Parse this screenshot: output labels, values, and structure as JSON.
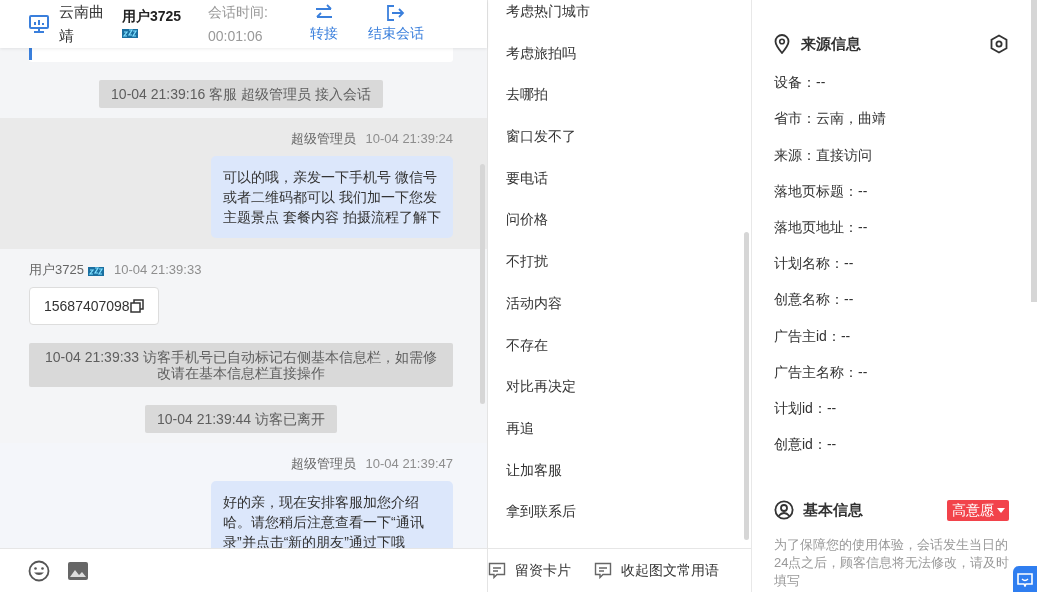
{
  "header": {
    "location": "云南曲靖",
    "user": "用户3725",
    "session_label": "会话时间:",
    "session_time": "00:01:06",
    "actions": [
      {
        "kind": "transfer",
        "label": "转接"
      },
      {
        "kind": "end",
        "label": "结束会话"
      }
    ]
  },
  "messages": [
    {
      "kind": "card"
    },
    {
      "kind": "system",
      "text": "10-04 21:39:16 客服 超级管理员 接入会话"
    },
    {
      "kind": "agent",
      "highlighted": true,
      "sender": "超级管理员",
      "time": "10-04 21:39:24",
      "text": "可以的哦，亲发一下手机号 微信号或者二维码都可以 我们加一下您发主题景点 套餐内容 拍摄流程了解下"
    },
    {
      "kind": "visitor",
      "sender": "用户3725",
      "time": "10-04 21:39:33",
      "text": "15687407098"
    },
    {
      "kind": "system",
      "text": "10-04 21:39:33 访客手机号已自动标记右侧基本信息栏，如需修改请在基本信息栏直接操作"
    },
    {
      "kind": "system",
      "text": "10-04 21:39:44 访客已离开"
    },
    {
      "kind": "agent",
      "highlighted": false,
      "sender": "超级管理员",
      "time": "10-04 21:39:47",
      "text": "好的亲，现在安排客服加您介绍哈。请您稍后注意查看一下“通讯录”并点击“新的朋友”通过下哦"
    }
  ],
  "phrases": [
    "考虑热门城市",
    "考虑旅拍吗",
    "去哪拍",
    "窗口发不了",
    "要电话",
    "问价格",
    "不打扰",
    "活动内容",
    "不存在",
    "对比再决定",
    "再追",
    "让加客服",
    "拿到联系后"
  ],
  "phrase_actions": [
    "留资卡片",
    "收起图文常用语"
  ],
  "source": {
    "title": "来源信息",
    "fields": [
      "设备：--",
      "省市：云南，曲靖",
      "来源：直接访问",
      "落地页标题：--",
      "落地页地址：--",
      "计划名称：--",
      "创意名称：--",
      "广告主id：--",
      "广告主名称：--",
      "计划id：--",
      "创意id：--"
    ]
  },
  "basic": {
    "title": "基本信息",
    "intent": "高意愿",
    "note": "为了保障您的使用体验，会话发生当日的24点之后，顾客信息将无法修改，请及时填写"
  }
}
